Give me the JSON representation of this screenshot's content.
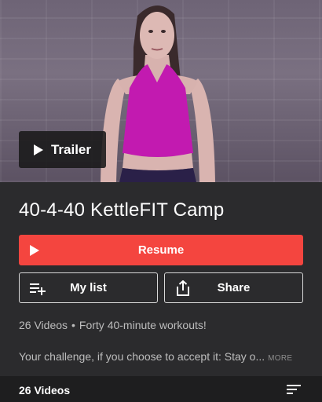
{
  "hero": {
    "trailer_label": "Trailer"
  },
  "program": {
    "title": "40-4-40 KettleFIT Camp",
    "resume_label": "Resume",
    "mylist_label": "My list",
    "share_label": "Share",
    "video_count": "26 Videos",
    "separator": "•",
    "tagline": "Forty 40-minute workouts!",
    "description": "Your challenge, if you choose to accept it: Stay o...",
    "more_label": "MORE"
  },
  "bottom_bar": {
    "label": "26 Videos"
  },
  "colors": {
    "accent": "#f4453f",
    "background": "#2b2b2d",
    "bottom_bar": "#1e1e1f"
  },
  "icons": [
    "play-icon",
    "add-to-list-icon",
    "share-icon",
    "sort-icon"
  ]
}
